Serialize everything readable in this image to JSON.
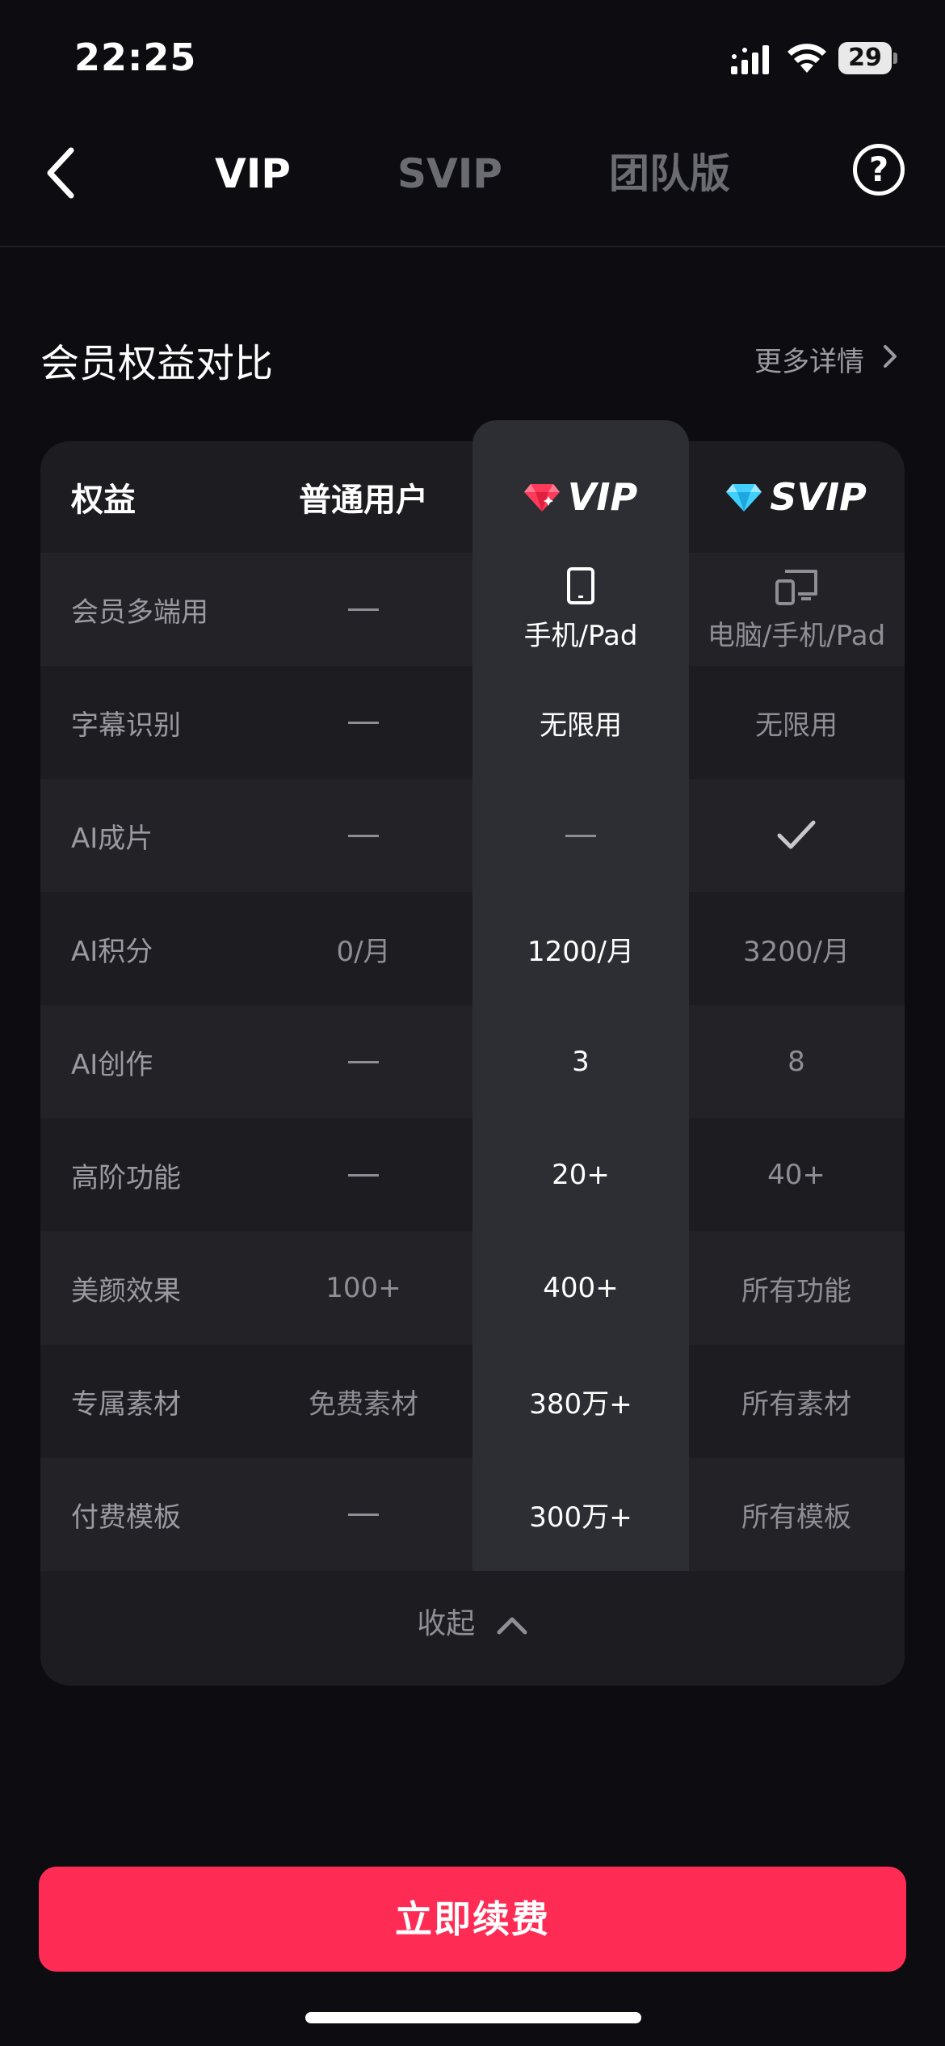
{
  "status_bar": {
    "time": "22:25",
    "battery": "29"
  },
  "nav": {
    "tabs": [
      {
        "label": "VIP",
        "active": true
      },
      {
        "label": "SVIP",
        "active": false
      },
      {
        "label": "团队版",
        "active": false
      }
    ],
    "help_icon": "?"
  },
  "section": {
    "title": "会员权益对比",
    "more_link": "更多详情"
  },
  "table": {
    "headers": {
      "label": "权益",
      "normal": "普通用户",
      "vip": "VIP",
      "svip": "SVIP"
    },
    "rows": [
      {
        "label": "会员多端用",
        "normal": "—",
        "vip": "手机/Pad",
        "svip": "电脑/手机/Pad"
      },
      {
        "label": "字幕识别",
        "normal": "—",
        "vip": "无限用",
        "svip": "无限用"
      },
      {
        "label": "AI成片",
        "normal": "—",
        "vip": "—",
        "svip": "✓"
      },
      {
        "label": "AI积分",
        "normal": "0/月",
        "vip": "1200/月",
        "svip": "3200/月"
      },
      {
        "label": "AI创作",
        "normal": "—",
        "vip": "3",
        "svip": "8"
      },
      {
        "label": "高阶功能",
        "normal": "—",
        "vip": "20+",
        "svip": "40+"
      },
      {
        "label": "美颜效果",
        "normal": "100+",
        "vip": "400+",
        "svip": "所有功能"
      },
      {
        "label": "专属素材",
        "normal": "免费素材",
        "vip": "380万+",
        "svip": "所有素材"
      },
      {
        "label": "付费模板",
        "normal": "—",
        "vip": "300万+",
        "svip": "所有模板"
      }
    ],
    "collapse_label": "收起"
  },
  "cta": {
    "label": "立即续费"
  },
  "colors": {
    "accent": "#fe2c55",
    "vip_gem": "#ff3b5c",
    "svip_gem": "#3fd0ff",
    "background": "#0c0c11"
  },
  "icons": [
    "back-chevron-icon",
    "help-icon",
    "chevron-right-icon",
    "ruby-gem-icon",
    "diamond-gem-icon",
    "tablet-icon",
    "desktop-phone-icon",
    "checkmark-icon",
    "chevron-up-icon"
  ]
}
